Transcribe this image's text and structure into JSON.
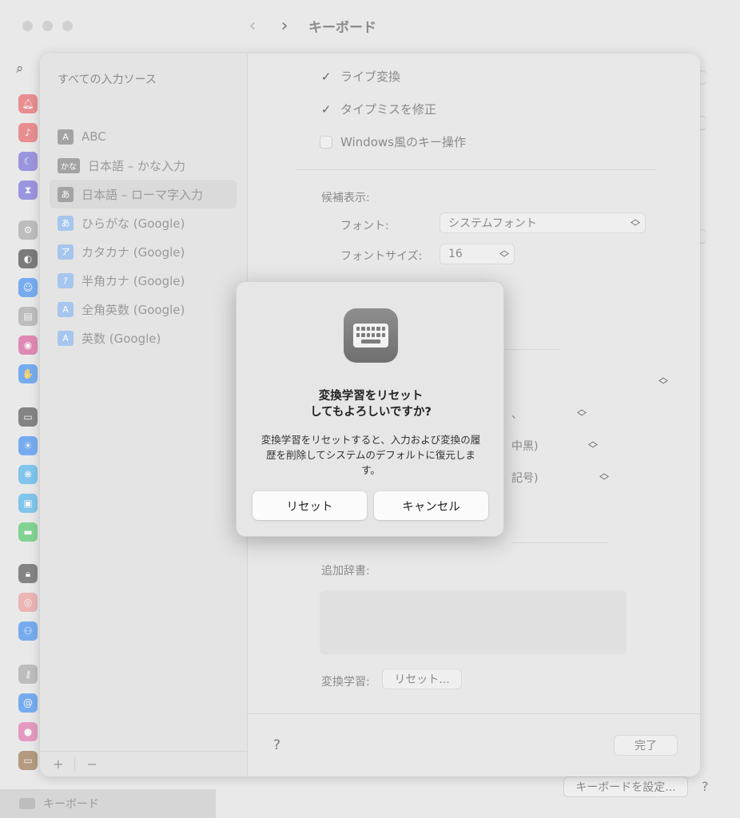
{
  "window": {
    "title": "キーボード",
    "sidebar_current": "キーボード",
    "configure_button": "キーボードを設定...",
    "help": "?"
  },
  "sheet": {
    "sources_header": "すべての入力ソース",
    "sources": [
      {
        "icon_text": "A",
        "label": "ABC",
        "selected": false
      },
      {
        "icon_text": "かな",
        "label": "日本語 – かな入力",
        "selected": false
      },
      {
        "icon_text": "あ",
        "label": "日本語 – ローマ字入力",
        "selected": true
      },
      {
        "icon_text": "あ",
        "label": "ひらがな (Google)",
        "selected": false
      },
      {
        "icon_text": "ア",
        "label": "カタカナ (Google)",
        "selected": false
      },
      {
        "icon_text": "ｱ",
        "label": "半角カナ (Google)",
        "selected": false
      },
      {
        "icon_text": "A",
        "label": "全角英数 (Google)",
        "selected": false
      },
      {
        "icon_text": "A",
        "label": "英数 (Google)",
        "selected": false
      }
    ],
    "add": "+",
    "remove": "−",
    "live_conversion": "ライブ変換",
    "typo_correction": "タイプミスを修正",
    "windows_keys": "Windows風のキー操作",
    "candidates_label": "候補表示:",
    "font_label": "フォント:",
    "font_value": "システムフォント",
    "font_size_label": "フォントサイズ:",
    "font_size_value": "16",
    "partial_1": "、",
    "partial_2": "中黒)",
    "partial_3": "記号)",
    "dictionary_label": "追加辞書:",
    "learning_label": "変換学習:",
    "learning_reset": "リセット...",
    "help": "?",
    "done": "完了"
  },
  "alert": {
    "title_line1": "変換学習をリセット",
    "title_line2": "してもよろしいですか?",
    "message": "変換学習をリセットすると、入力および変換の履歴を削除してシステムのデフォルトに復元します。",
    "reset_button": "リセット",
    "cancel_button": "キャンセル"
  }
}
